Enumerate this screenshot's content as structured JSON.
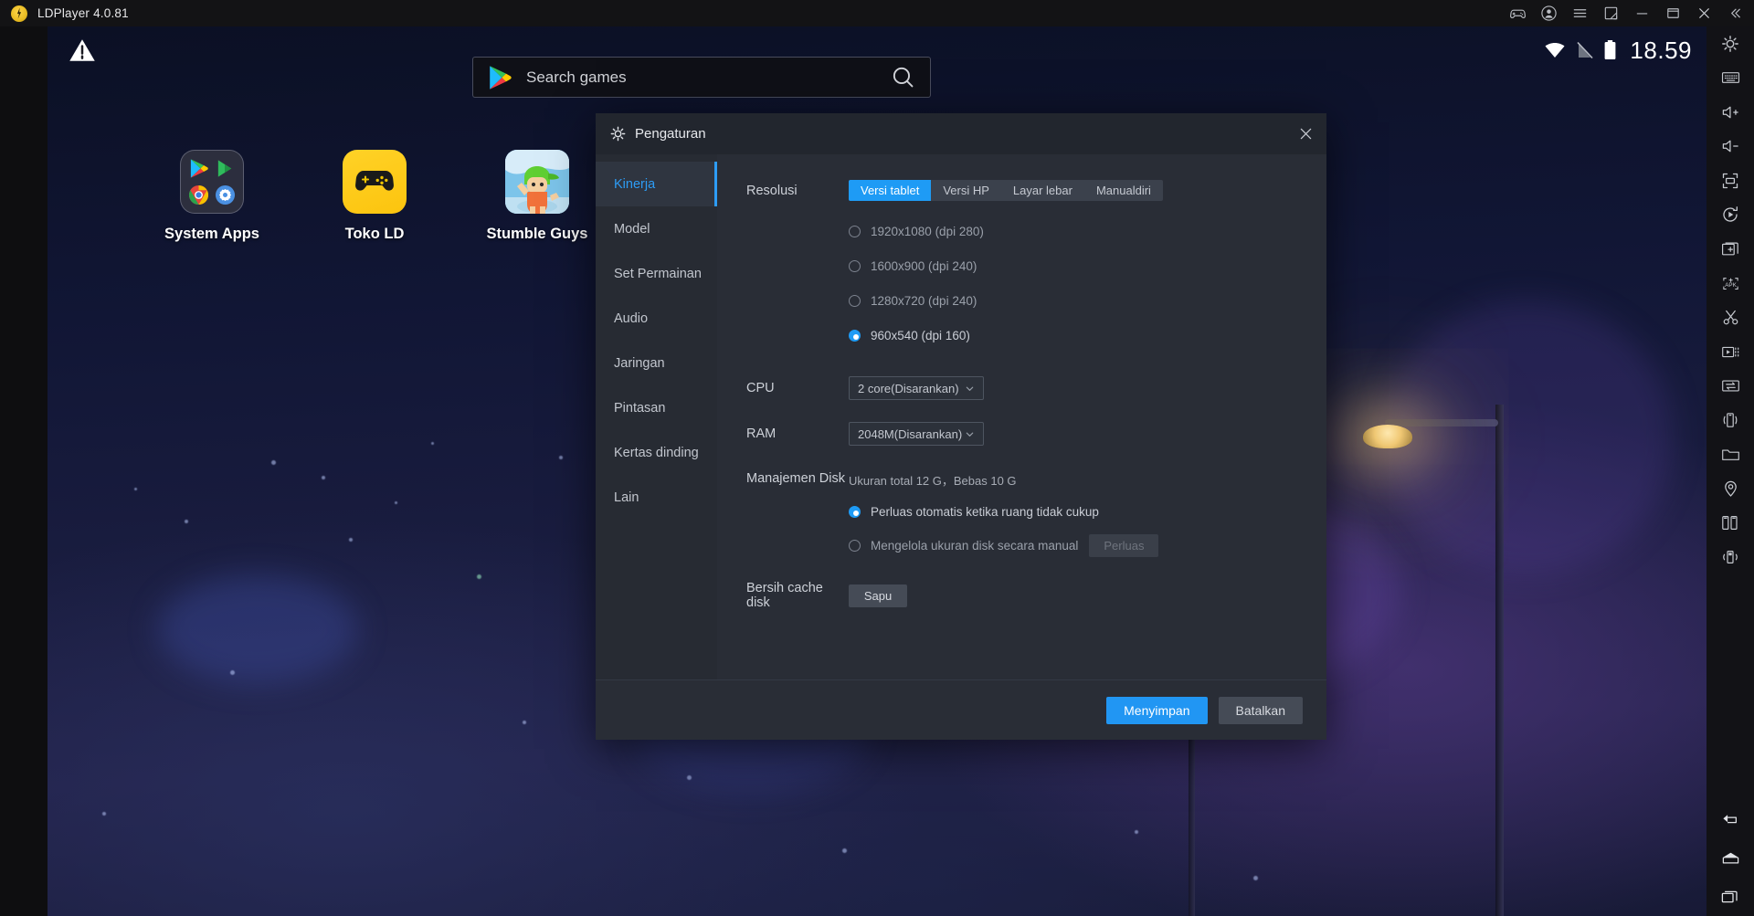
{
  "titlebar": {
    "app_title": "LDPlayer 4.0.81",
    "logo_name": "ldplayer-logo",
    "icons": [
      {
        "name": "gamepad-icon",
        "label": "gamepad"
      },
      {
        "name": "account-icon",
        "label": "account"
      },
      {
        "name": "menu-icon",
        "label": "menu"
      },
      {
        "name": "resize-icon",
        "label": "resize"
      },
      {
        "name": "minimize-icon",
        "label": "minimize"
      },
      {
        "name": "maximize-icon",
        "label": "maximize"
      },
      {
        "name": "close-icon",
        "label": "close"
      },
      {
        "name": "collapse-icon",
        "label": "collapse"
      }
    ]
  },
  "screen": {
    "warning_icon": "warning-icon",
    "statusbar": {
      "wifi_icon": "wifi-icon",
      "signal_icon": "no-sim-icon",
      "battery_icon": "battery-icon",
      "time": "18.59"
    },
    "search": {
      "placeholder": "Search games",
      "play_icon": "google-play-icon",
      "search_icon": "search-icon"
    },
    "apps": [
      {
        "name": "system-apps",
        "label": "System Apps"
      },
      {
        "name": "toko-ld",
        "label": "Toko LD"
      },
      {
        "name": "stumble-guys",
        "label": "Stumble Guys"
      }
    ]
  },
  "toolbar": {
    "items": [
      {
        "name": "settings-gear-icon",
        "label": "Settings"
      },
      {
        "name": "keyboard-icon",
        "label": "Keyboard"
      },
      {
        "name": "volume-up-icon",
        "label": "Volume up"
      },
      {
        "name": "volume-down-icon",
        "label": "Volume down"
      },
      {
        "name": "fullscreen-icon",
        "label": "Fullscreen"
      },
      {
        "name": "rotate-icon",
        "label": "Rotate"
      },
      {
        "name": "add-window-icon",
        "label": "New window"
      },
      {
        "name": "install-apk-icon",
        "label": "Install APK"
      },
      {
        "name": "scissors-icon",
        "label": "Cut"
      },
      {
        "name": "record-video-icon",
        "label": "Record"
      },
      {
        "name": "transfer-icon",
        "label": "Transfer"
      },
      {
        "name": "shake-icon",
        "label": "Shake"
      },
      {
        "name": "folder-icon",
        "label": "Shared folder"
      },
      {
        "name": "location-icon",
        "label": "Location"
      },
      {
        "name": "multi-instance-icon",
        "label": "Multi instance"
      },
      {
        "name": "vibrate-icon",
        "label": "Vibrate"
      }
    ],
    "nav": [
      {
        "name": "nav-back-icon",
        "label": "Back"
      },
      {
        "name": "nav-home-icon",
        "label": "Home"
      },
      {
        "name": "nav-recents-icon",
        "label": "Recents"
      }
    ]
  },
  "dialog": {
    "title": "Pengaturan",
    "gear_icon": "gear-icon",
    "close_icon": "close-icon",
    "sidebar": [
      {
        "label": "Kinerja",
        "active": true
      },
      {
        "label": "Model",
        "active": false
      },
      {
        "label": "Set Permainan",
        "active": false
      },
      {
        "label": "Audio",
        "active": false
      },
      {
        "label": "Jaringan",
        "active": false
      },
      {
        "label": "Pintasan",
        "active": false
      },
      {
        "label": "Kertas dinding",
        "active": false
      },
      {
        "label": "Lain",
        "active": false
      }
    ],
    "resolution": {
      "label": "Resolusi",
      "tabs": [
        {
          "label": "Versi tablet",
          "active": true
        },
        {
          "label": "Versi HP",
          "active": false
        },
        {
          "label": "Layar lebar",
          "active": false
        },
        {
          "label": "Manualdiri",
          "active": false
        }
      ],
      "options": [
        {
          "label": "1920x1080  (dpi 280)",
          "selected": false
        },
        {
          "label": "1600x900  (dpi 240)",
          "selected": false
        },
        {
          "label": "1280x720  (dpi 240)",
          "selected": false
        },
        {
          "label": "960x540  (dpi 160)",
          "selected": true
        }
      ]
    },
    "cpu": {
      "label": "CPU",
      "value": "2 core(Disarankan)"
    },
    "ram": {
      "label": "RAM",
      "value": "2048M(Disarankan)"
    },
    "disk": {
      "label": "Manajemen Disk",
      "info": "Ukuran total 12 G，Bebas 10 G",
      "options": [
        {
          "label": "Perluas otomatis ketika ruang tidak cukup",
          "selected": true
        },
        {
          "label": "Mengelola ukuran disk secara manual",
          "selected": false
        }
      ],
      "expand_button": "Perluas"
    },
    "cache": {
      "label": "Bersih cache disk",
      "button": "Sapu"
    },
    "footer": {
      "save": "Menyimpan",
      "cancel": "Batalkan"
    }
  },
  "colors": {
    "accent": "#1e9bf5",
    "dialog_bg": "#292d36",
    "titlebar_bg": "#131315"
  }
}
